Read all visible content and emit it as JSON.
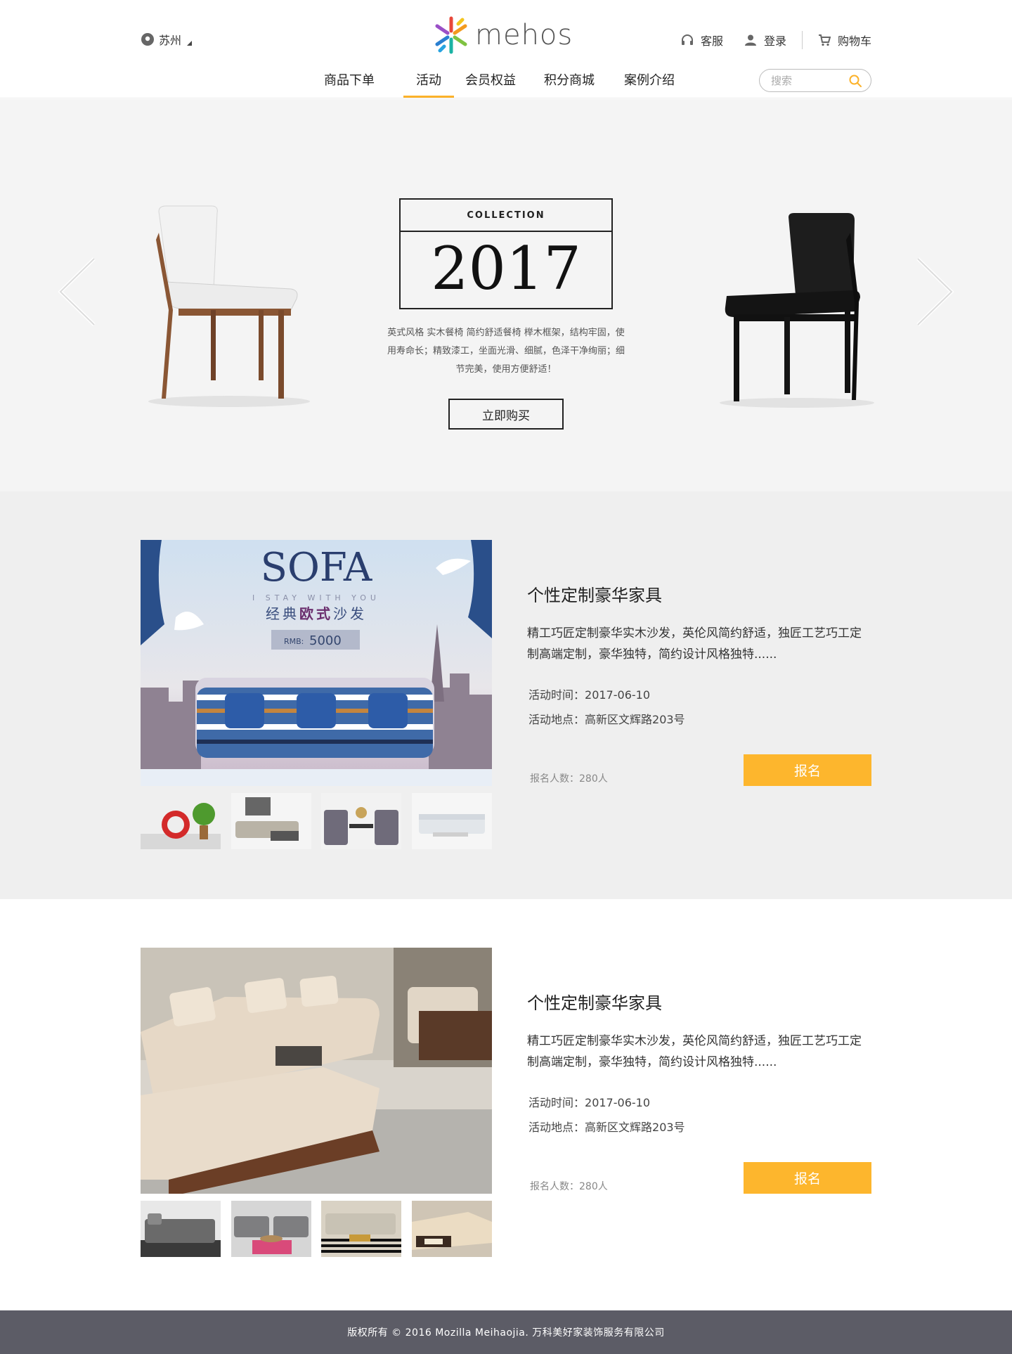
{
  "header": {
    "location": "苏州",
    "logo_text": "mehos",
    "service": "客服",
    "login": "登录",
    "cart": "购物车"
  },
  "nav": {
    "tabs": [
      {
        "label": "商品下单"
      },
      {
        "label": "活动"
      },
      {
        "label": "会员权益"
      },
      {
        "label": "积分商城"
      },
      {
        "label": "案例介绍"
      }
    ],
    "active": "活动",
    "search_placeholder": "搜索"
  },
  "hero": {
    "collection_label": "COLLECTION",
    "year": "2017",
    "description": "英式风格 实木餐椅 简约舒适餐椅  榉木框架，结构牢固，使用寿命长；精致漆工，坐面光滑、细腻，色泽干净绚丽；细节完美，使用方便舒适！",
    "buy_button": "立即购买"
  },
  "events": [
    {
      "banner_title": "SOFA",
      "banner_sub_en": "I STAY WITH YOU",
      "banner_sub_cn_1": "经典",
      "banner_sub_cn_2": "欧式",
      "banner_sub_cn_3": "沙发",
      "banner_price_label": "RMB:",
      "banner_price": "5000",
      "title": "个性定制豪华家具",
      "description": "精工巧匠定制豪华实木沙发，英伦风简约舒适，独匠工艺巧工定制高端定制，豪华独特，简约设计风格独特......",
      "time_label": "活动时间：",
      "time": "2017-06-10",
      "place_label": "活动地点：",
      "place": "高新区文辉路203号",
      "count_label": "报名人数：",
      "count": "280人",
      "signup": "报名"
    },
    {
      "title": "个性定制豪华家具",
      "description": "精工巧匠定制豪华实木沙发，英伦风简约舒适，独匠工艺巧工定制高端定制，豪华独特，简约设计风格独特......",
      "time_label": "活动时间：",
      "time": "2017-06-10",
      "place_label": "活动地点：",
      "place": "高新区文辉路203号",
      "count_label": "报名人数：",
      "count": "280人",
      "signup": "报名"
    }
  ],
  "footer": {
    "copyright": "版权所有 © 2016 Mozilla Meihaojia. 万科美好家装饰服务有限公司"
  },
  "colors": {
    "accent": "#fdb62d",
    "footer_bg": "#5c5c66",
    "hero_bg": "#f4f4f4",
    "section_gray": "#efefef"
  }
}
